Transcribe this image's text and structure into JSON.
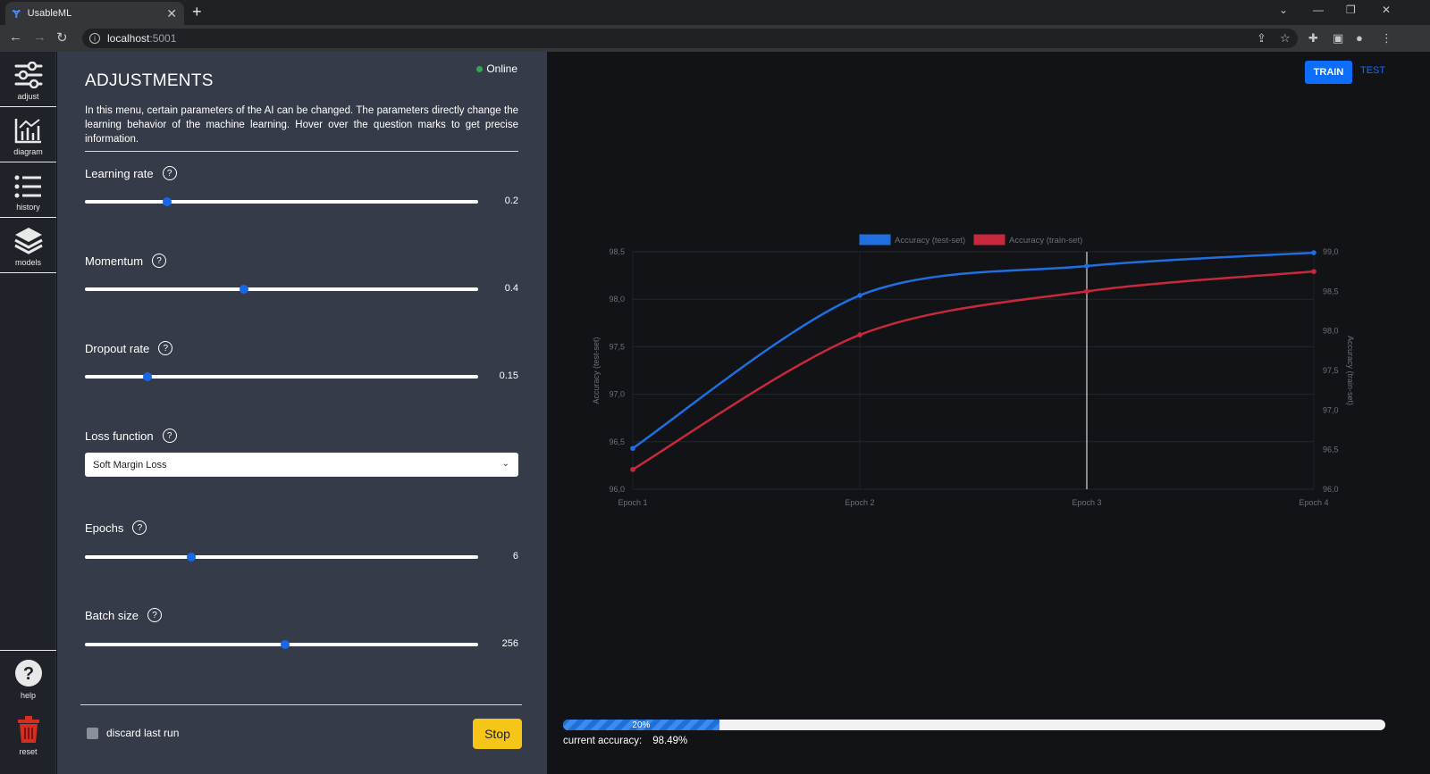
{
  "browser": {
    "tab_title": "UsableML",
    "url_host": "localhost",
    "url_port": ":5001"
  },
  "sidebar": {
    "items": [
      {
        "label": "adjust",
        "icon": "sliders-icon"
      },
      {
        "label": "diagram",
        "icon": "chart-icon"
      },
      {
        "label": "history",
        "icon": "list-icon"
      },
      {
        "label": "models",
        "icon": "layers-icon"
      }
    ],
    "bottom": [
      {
        "label": "help",
        "icon": "help-icon"
      },
      {
        "label": "reset",
        "icon": "trash-icon"
      }
    ]
  },
  "panel": {
    "title": "ADJUSTMENTS",
    "status": "Online",
    "description": "In this menu, certain parameters of the AI can be changed. The parameters directly change the learning behavior of the machine learning. Hover over the question marks to get precise information.",
    "params": [
      {
        "label": "Learning rate",
        "value": "0.2",
        "fraction": 0.21
      },
      {
        "label": "Momentum",
        "value": "0.4",
        "fraction": 0.405
      },
      {
        "label": "Dropout rate",
        "value": "0.15",
        "fraction": 0.16
      },
      {
        "label": "Loss function",
        "value": "Soft Margin Loss"
      },
      {
        "label": "Epochs",
        "value": "6",
        "fraction": 0.27
      },
      {
        "label": "Batch size",
        "value": "256",
        "fraction": 0.51
      }
    ],
    "discard_label": "discard last run",
    "stop_label": "Stop"
  },
  "main": {
    "train_label": "TRAIN",
    "test_label": "TEST",
    "progress_label": "20%",
    "progress_fraction": 0.19,
    "accuracy_label": "current accuracy:",
    "accuracy_value": "98.49%"
  },
  "chart_data": {
    "type": "line",
    "categories": [
      "Epoch 1",
      "Epoch 2",
      "Epoch 3",
      "Epoch 4"
    ],
    "series": [
      {
        "name": "Accuracy (test-set)",
        "axis": "left",
        "color": "#1f6fe0",
        "values": [
          96.43,
          98.04,
          98.35,
          98.49
        ]
      },
      {
        "name": "Accuracy (train-set)",
        "axis": "right",
        "color": "#c8283c",
        "values": [
          96.25,
          97.95,
          98.5,
          98.75
        ]
      }
    ],
    "y_left": {
      "label": "Accuracy (test-set)",
      "range": [
        96.0,
        98.5
      ],
      "ticks": [
        "98,5",
        "98,0",
        "97,5",
        "97,0",
        "96,5",
        "96,0"
      ]
    },
    "y_right": {
      "label": "Accuracy (train-set)",
      "range": [
        96.0,
        99.0
      ],
      "ticks": [
        "99,0",
        "98,5",
        "98,0",
        "97,5",
        "97,0",
        "96,5",
        "96,0"
      ]
    },
    "hover_category": "Epoch 3",
    "legend": "top-center"
  }
}
